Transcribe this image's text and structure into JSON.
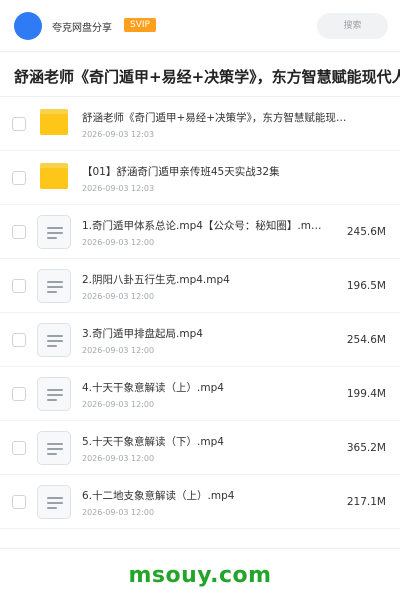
{
  "header": {
    "app_name": "夸克网盘分享",
    "badge": "SVIP",
    "search_label": "搜索"
  },
  "folder": {
    "title": "舒涵老师《奇门遁甲+易经+决策学》，东方智慧赋能现代人"
  },
  "rows": [
    {
      "type": "folder",
      "name": "舒涵老师《奇门遁甲+易经+决策学》，东方智慧赋能现…",
      "date": "2026-09-03 12:03",
      "size": ""
    },
    {
      "type": "folder",
      "name": "【01】舒涵奇门遁甲亲传班45天实战32集",
      "date": "2026-09-03 12:03",
      "size": ""
    },
    {
      "type": "file",
      "name": "1.奇门遁甲体系总论.mp4【公众号：秘知圈】.m…",
      "date": "2026-09-03 12:00",
      "size": "245.6M"
    },
    {
      "type": "file",
      "name": "2.阴阳八卦五行生克.mp4.mp4",
      "date": "2026-09-03 12:00",
      "size": "196.5M"
    },
    {
      "type": "file",
      "name": "3.奇门遁甲排盘起局.mp4",
      "date": "2026-09-03 12:00",
      "size": "254.6M"
    },
    {
      "type": "file",
      "name": "4.十天干象意解读（上）.mp4",
      "date": "2026-09-03 12:00",
      "size": "199.4M"
    },
    {
      "type": "file",
      "name": "5.十天干象意解读（下）.mp4",
      "date": "2026-09-03 12:00",
      "size": "365.2M"
    },
    {
      "type": "file",
      "name": "6.十二地支象意解读（上）.mp4",
      "date": "2026-09-03 12:00",
      "size": "217.1M"
    }
  ],
  "watermark": "msouy.com",
  "colors": {
    "avatar": "#2f7bf6",
    "svip": "#ff9f1c",
    "folder": "#ffc61a",
    "watermark": "#23a52a"
  }
}
